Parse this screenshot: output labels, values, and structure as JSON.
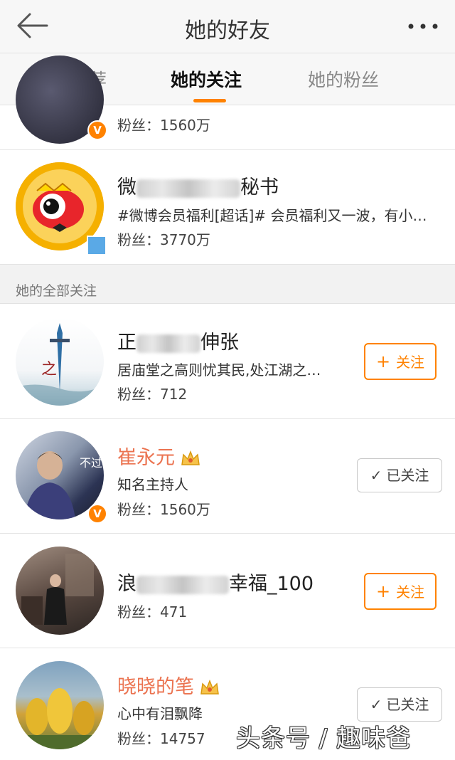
{
  "header": {
    "title": "她的好友"
  },
  "tabs": [
    {
      "label": "推荐"
    },
    {
      "label": "她的关注"
    },
    {
      "label": "她的粉丝"
    }
  ],
  "accent_color": "#ff8200",
  "rows_top": [
    {
      "fans": "粉丝：1560万",
      "verified": true
    },
    {
      "name_start": "微",
      "name_end": "秘书",
      "desc": "#微博会员福利[超话]# 会员福利又一波，有小…",
      "fans": "粉丝：3770万"
    }
  ],
  "section": {
    "title": "她的全部关注"
  },
  "list": [
    {
      "name_start": "正",
      "name_end": "伸张",
      "desc": "居庙堂之高则忧其民,处江湖之…",
      "fans": "粉丝：712",
      "button": "关注",
      "button_icon": "plus-icon"
    },
    {
      "name": "崔永元",
      "desc": "知名主持人",
      "fans": "粉丝：1560万",
      "button": "已关注",
      "button_icon": "check-icon",
      "avatar_text": "不过如此"
    },
    {
      "name_start": "浪",
      "name_end": "幸福_100",
      "fans": "粉丝：471",
      "button": "关注",
      "button_icon": "plus-icon"
    },
    {
      "name": "晓晓的笔",
      "desc": "心中有泪飘降",
      "fans": "粉丝：14757",
      "button": "已关注",
      "button_icon": "check-icon"
    }
  ],
  "watermark": "头条号 / 趣味爸"
}
